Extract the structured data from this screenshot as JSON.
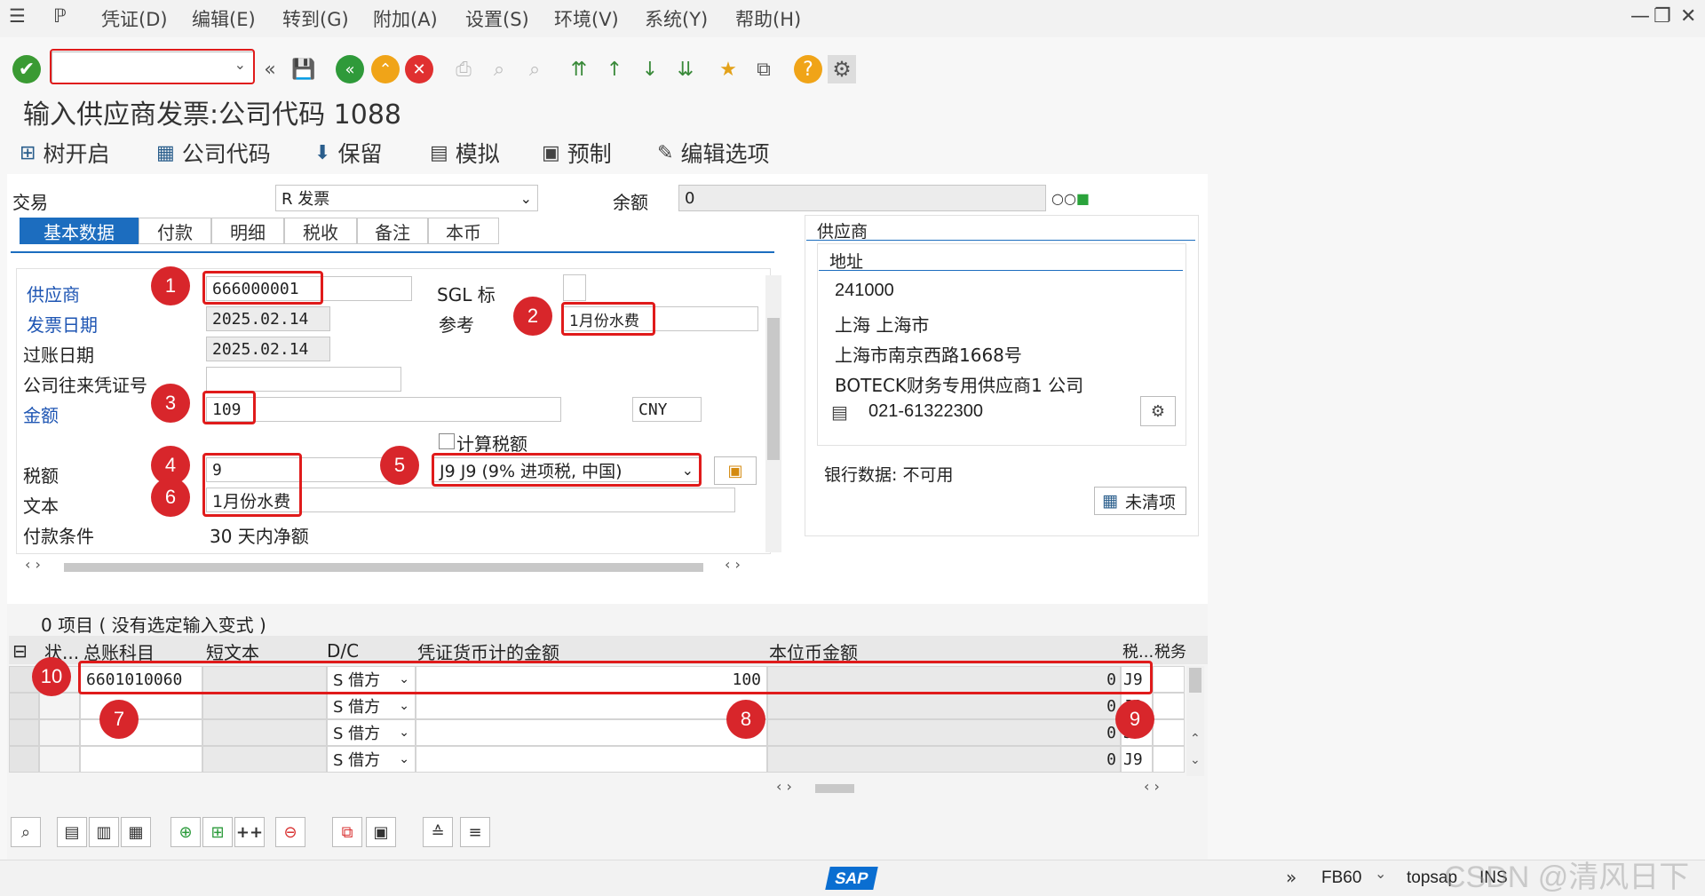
{
  "menu": {
    "items": [
      "凭证(D)",
      "编辑(E)",
      "转到(G)",
      "附加(A)",
      "设置(S)",
      "环境(V)",
      "系统(Y)",
      "帮助(H)"
    ]
  },
  "title": "输入供应商发票:公司代码 1088",
  "app_toolbar": {
    "tree": "树开启",
    "company_code": "公司代码",
    "hold": "保留",
    "simulate": "模拟",
    "park": "预制",
    "edit_options": "编辑选项"
  },
  "header": {
    "transaction_label": "交易",
    "transaction_value": "R 发票",
    "balance_label": "余额",
    "balance_value": "0"
  },
  "tabs": [
    "基本数据",
    "付款",
    "明细",
    "税收",
    "备注",
    "本币"
  ],
  "basic": {
    "vendor_label": "供应商",
    "vendor_value": "666000001",
    "sgl_label": "SGL 标",
    "invoice_date_label": "发票日期",
    "invoice_date_value": "2025.02.14",
    "reference_label": "参考",
    "reference_value": "1月份水费",
    "posting_date_label": "过账日期",
    "posting_date_value": "2025.02.14",
    "cross_cc_label": "公司往来凭证号",
    "amount_label": "金额",
    "amount_value": "109",
    "currency": "CNY",
    "calc_tax_label": "计算税额",
    "tax_label": "税额",
    "tax_value": "9",
    "tax_code_value": "J9 J9 (9% 进项税, 中国)",
    "text_label": "文本",
    "text_value": "1月份水费",
    "payment_terms_label": "付款条件",
    "payment_terms_value": "30 天内净额"
  },
  "vendor_panel": {
    "title": "供应商",
    "address_title": "地址",
    "postal": "241000",
    "city": "上海   上海市",
    "street": "上海市南京西路1668号",
    "name": "BOTECK财务专用供应商1 公司",
    "phone": "021-61322300",
    "bank_data": "银行数据: 不可用",
    "open_items": "未清项"
  },
  "items": {
    "summary": "0 项目 ( 没有选定输入变式 )",
    "columns": [
      "状...",
      "总账科目",
      "短文本",
      "D/C",
      "凭证货币计的金额",
      "本位币金额",
      "税...",
      "税务"
    ],
    "rows": [
      {
        "gl": "6601010060",
        "dc": "S 借方",
        "amount": "100",
        "local": "0",
        "tax": "J9"
      },
      {
        "gl": "",
        "dc": "S 借方",
        "amount": "",
        "local": "0",
        "tax": "J9"
      },
      {
        "gl": "",
        "dc": "S 借方",
        "amount": "",
        "local": "0",
        "tax": "J9"
      },
      {
        "gl": "",
        "dc": "S 借方",
        "amount": "",
        "local": "0",
        "tax": "J9"
      }
    ]
  },
  "badges": [
    "1",
    "2",
    "3",
    "4",
    "5",
    "6",
    "7",
    "8",
    "9",
    "10"
  ],
  "status": {
    "sap": "SAP",
    "tcode": "FB60",
    "system": "topsap",
    "mode": "INS",
    "watermark": "CSDN @清风日下"
  },
  "colors": {
    "accent": "#1c6dbf",
    "annotation_red": "#e01b1b",
    "label_blue": "#1e55b3"
  }
}
